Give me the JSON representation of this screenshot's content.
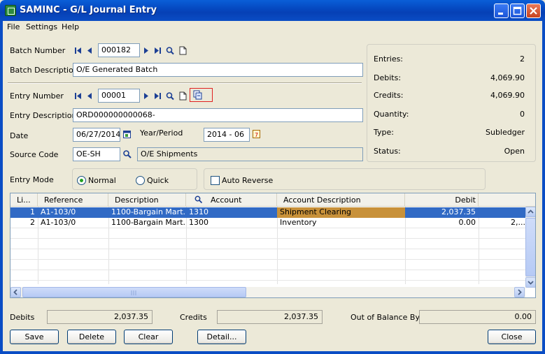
{
  "window": {
    "title": "SAMINC - G/L Journal Entry"
  },
  "menu": [
    {
      "label": "File",
      "key": "F"
    },
    {
      "label": "Settings",
      "key": "S"
    },
    {
      "label": "Help",
      "key": "H"
    }
  ],
  "batch": {
    "number_label": "Batch Number",
    "number": "000182",
    "description_label": "Batch Description",
    "description": "O/E Generated Batch"
  },
  "entry": {
    "number_label": "Entry Number",
    "number": "00001",
    "description_label": "Entry Description",
    "description": "ORD000000000068-",
    "date_label": "Date",
    "date": "06/27/2014",
    "year_period_label": "Year/Period",
    "year_period": "2014 - 06",
    "source_code_label": "Source Code",
    "source_code": "OE-SH",
    "source_description": "O/E Shipments",
    "mode_label": "Entry Mode",
    "mode_normal": "Normal",
    "mode_quick": "Quick",
    "mode_selected": "Normal",
    "auto_reverse_label": "Auto Reverse",
    "auto_reverse_checked": false
  },
  "summary": {
    "entries_label": "Entries:",
    "entries": "2",
    "debits_label": "Debits:",
    "debits": "4,069.90",
    "credits_label": "Credits:",
    "credits": "4,069.90",
    "quantity_label": "Quantity:",
    "quantity": "0",
    "type_label": "Type:",
    "type": "Subledger",
    "status_label": "Status:",
    "status": "Open"
  },
  "grid": {
    "columns": [
      "Li...",
      "Reference",
      "Description",
      "Account",
      "Account Description",
      "Debit"
    ],
    "rows": [
      {
        "line": "1",
        "reference": "A1-103/0",
        "description": "1100-Bargain Mart...",
        "account": "1310",
        "account_description": "Shipment Clearing",
        "debit": "2,037.35",
        "credit": ""
      },
      {
        "line": "2",
        "reference": "A1-103/0",
        "description": "1100-Bargain Mart...",
        "account": "1300",
        "account_description": "Inventory",
        "debit": "0.00",
        "credit": "2,..."
      }
    ]
  },
  "totals": {
    "debits_label": "Debits",
    "debits": "2,037.35",
    "credits_label": "Credits",
    "credits": "2,037.35",
    "out_of_balance_label": "Out of Balance By",
    "out_of_balance": "0.00"
  },
  "buttons": {
    "save": "Save",
    "delete": "Delete",
    "clear": "Clear",
    "detail": "Detail...",
    "close": "Close"
  },
  "colors": {
    "titlebar": "#0a4dc5",
    "selected_row": "#316ac5",
    "highlight_cell": "#c8913a",
    "focus_outline": "#e02020"
  }
}
